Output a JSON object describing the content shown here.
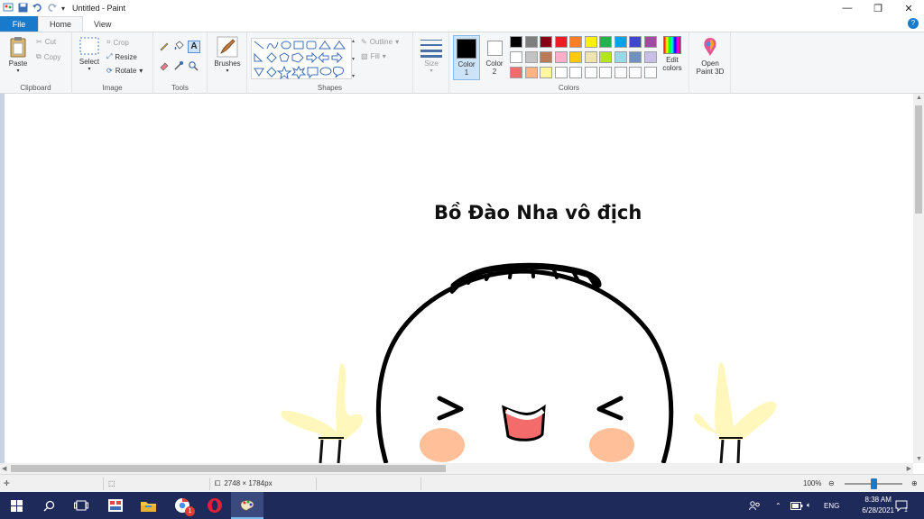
{
  "window": {
    "title": "Untitled - Paint",
    "minimize": "—",
    "restore": "❐",
    "close": "✕"
  },
  "tabs": {
    "file": "File",
    "home": "Home",
    "view": "View",
    "help": "?"
  },
  "ribbon": {
    "clipboard": {
      "label": "Clipboard",
      "paste": "Paste",
      "cut": "Cut",
      "copy": "Copy"
    },
    "image": {
      "label": "Image",
      "select": "Select",
      "crop": "Crop",
      "resize": "Resize",
      "rotate": "Rotate"
    },
    "tools": {
      "label": "Tools"
    },
    "brushes": {
      "label": "Brushes"
    },
    "shapes": {
      "label": "Shapes",
      "outline": "Outline",
      "fill": "Fill"
    },
    "size": {
      "label": "Size"
    },
    "colors": {
      "label": "Colors",
      "color1": "Color",
      "color1_num": "1",
      "color2": "Color",
      "color2_num": "2",
      "edit": "Edit",
      "edit2": "colors",
      "color1_value": "#000000",
      "color2_value": "#ffffff",
      "palette": [
        [
          "#000000",
          "#7f7f7f",
          "#880015",
          "#ed1c24",
          "#ff7f27",
          "#fff200",
          "#22b14c",
          "#00a2e8",
          "#3f48cc",
          "#a349a4"
        ],
        [
          "#ffffff",
          "#c3c3c3",
          "#b97a57",
          "#ffaec9",
          "#ffc90e",
          "#efe4b0",
          "#b5e61d",
          "#99d9ea",
          "#7092be",
          "#c8bfe7"
        ],
        [
          "#f06b6b",
          "#ffb482",
          "#fff7a0",
          "#ffffff",
          "#ffffff",
          "#ffffff",
          "#ffffff",
          "#ffffff",
          "#ffffff",
          "#ffffff"
        ]
      ]
    },
    "paint3d": {
      "line1": "Open",
      "line2": "Paint 3D"
    }
  },
  "canvas": {
    "caption": "Bồ Đào Nha vô địch"
  },
  "status": {
    "dimensions": "2748 × 1784px",
    "zoom": "100%"
  },
  "taskbar": {
    "lang": "ENG",
    "time": "8:38 AM",
    "date": "6/28/2021",
    "chrome_badge": "1",
    "notification_count": "1"
  }
}
